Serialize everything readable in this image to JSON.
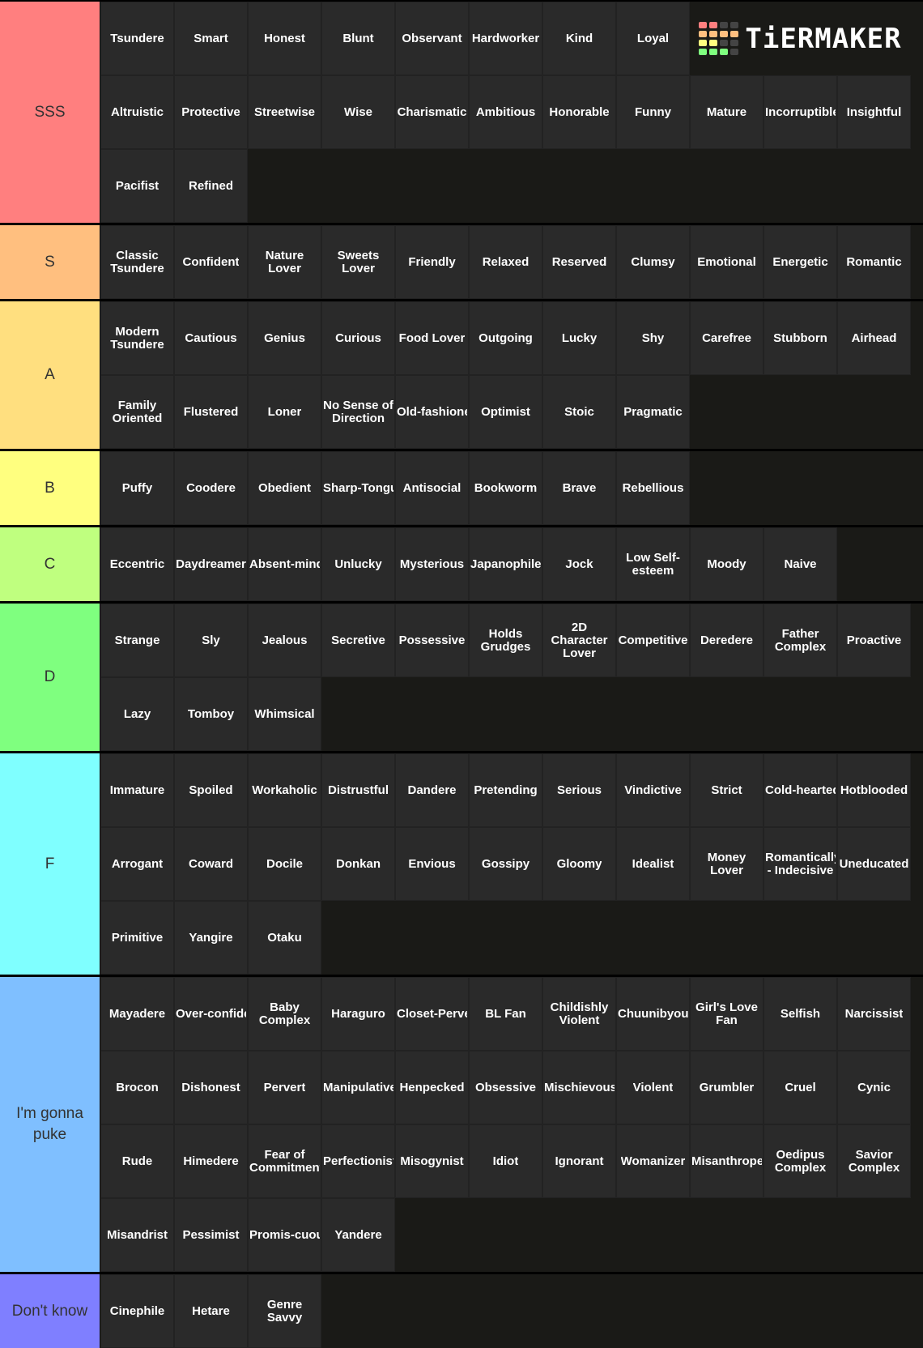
{
  "logo": {
    "text": "TiERMAKER",
    "grid_colors": [
      "#ff7f7f",
      "#ff7f7f",
      "#444",
      "#444",
      "#ffbf7f",
      "#ffbf7f",
      "#ffbf7f",
      "#ffbf7f",
      "#ffff7f",
      "#ffff7f",
      "#444",
      "#444",
      "#7fff7f",
      "#7fff7f",
      "#7fff7f",
      "#444"
    ]
  },
  "tiers": [
    {
      "label": "SSS",
      "color": "#ff7f7f",
      "items": [
        "Tsundere",
        "Smart",
        "Honest",
        "Blunt",
        "Observant",
        "Hardworker",
        "Kind",
        "Loyal",
        "Altruistic",
        "Protective",
        "Streetwise",
        "Wise",
        "Charismatic",
        "Ambitious",
        "Honorable",
        "Funny",
        "Mature",
        "Incorruptible",
        "Insightful",
        "Pacifist",
        "Refined"
      ]
    },
    {
      "label": "S",
      "color": "#ffbf7f",
      "items": [
        "Classic Tsundere",
        "Confident",
        "Nature Lover",
        "Sweets Lover",
        "Friendly",
        "Relaxed",
        "Reserved",
        "Clumsy",
        "Emotional",
        "Energetic",
        "Romantic"
      ]
    },
    {
      "label": "A",
      "color": "#ffdf7f",
      "items": [
        "Modern Tsundere",
        "Cautious",
        "Genius",
        "Curious",
        "Food Lover",
        "Outgoing",
        "Lucky",
        "Shy",
        "Carefree",
        "Stubborn",
        "Airhead",
        "Family Oriented",
        "Flustered",
        "Loner",
        "No Sense of Direction",
        "Old-fashioned",
        "Optimist",
        "Stoic",
        "Pragmatic"
      ]
    },
    {
      "label": "B",
      "color": "#ffff7f",
      "items": [
        "Puffy",
        "Coodere",
        "Obedient",
        "Sharp-Tongued",
        "Antisocial",
        "Bookworm",
        "Brave",
        "Rebellious"
      ]
    },
    {
      "label": "C",
      "color": "#bfff7f",
      "items": [
        "Eccentric",
        "Daydreamer",
        "Absent-minded",
        "Unlucky",
        "Mysterious",
        "Japanophile",
        "Jock",
        "Low Self-esteem",
        "Moody",
        "Naive"
      ]
    },
    {
      "label": "D",
      "color": "#7fff7f",
      "items": [
        "Strange",
        "Sly",
        "Jealous",
        "Secretive",
        "Possessive",
        "Holds Grudges",
        "2D Character Lover",
        "Competitive",
        "Deredere",
        "Father Complex",
        "Proactive",
        "Lazy",
        "Tomboy",
        "Whimsical"
      ]
    },
    {
      "label": "F",
      "color": "#7fffff",
      "items": [
        "Immature",
        "Spoiled",
        "Workaholic",
        "Distrustful",
        "Dandere",
        "Pretending",
        "Serious",
        "Vindictive",
        "Strict",
        "Cold-hearted",
        "Hotblooded",
        "Arrogant",
        "Coward",
        "Docile",
        "Donkan",
        "Envious",
        "Gossipy",
        "Gloomy",
        "Idealist",
        "Money Lover",
        "Romantically - Indecisive",
        "Uneducated",
        "Primitive",
        "Yangire",
        "Otaku"
      ]
    },
    {
      "label": "I'm gonna puke",
      "color": "#7fbfff",
      "items": [
        "Mayadere",
        "Over-confident",
        "Baby Complex",
        "Haraguro",
        "Closet-Pervert",
        "BL Fan",
        "Childishly Violent",
        "Chuunibyou",
        "Girl's Love Fan",
        "Selfish",
        "Narcissist",
        "Brocon",
        "Dishonest",
        "Pervert",
        "Manipulative",
        "Henpecked",
        "Obsessive",
        "Mischievous",
        "Violent",
        "Grumbler",
        "Cruel",
        "Cynic",
        "Rude",
        "Himedere",
        "Fear of Commitment",
        "Perfectionist",
        "Misogynist",
        "Idiot",
        "Ignorant",
        "Womanizer",
        "Misanthrope",
        "Oedipus Complex",
        "Savior Complex",
        "Misandrist",
        "Pessimist",
        "Promis-cuous",
        "Yandere"
      ]
    },
    {
      "label": "Don't know",
      "color": "#7f7fff",
      "items": [
        "Cinephile",
        "Hetare",
        "Genre Savvy"
      ]
    }
  ]
}
